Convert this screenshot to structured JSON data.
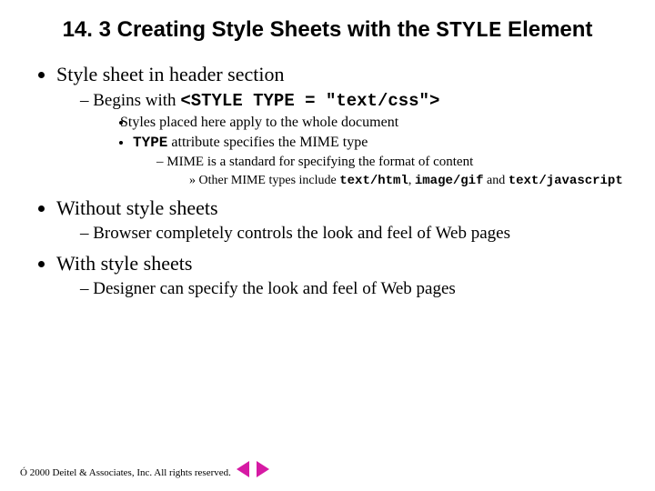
{
  "title": {
    "pre": "14. 3 Creating Style Sheets with the ",
    "code": "STYLE",
    "post": " Element"
  },
  "bullets": {
    "b1": "Style sheet in header section",
    "b1s1_pre": "Begins with ",
    "b1s1_code": "<STYLE TYPE = \"text/css\">",
    "b1s1a": "Styles placed here apply to the whole document",
    "b1s1b_code": "TYPE",
    "b1s1b_post": " attribute specifies the MIME type",
    "b1s1b_i": "MIME is a standard for specifying the format of content",
    "b1s1b_i_a_pre": "Other MIME types include ",
    "b1s1b_i_a_c1": "text/html",
    "b1s1b_i_a_mid1": ", ",
    "b1s1b_i_a_c2": "image/gif",
    "b1s1b_i_a_mid2": " and ",
    "b1s1b_i_a_c3": "text/javascript",
    "b2": "Without style sheets",
    "b2s1": "Browser completely controls the look and feel of Web pages",
    "b3": "With style sheets",
    "b3s1": "Designer can specify the look and feel of Web pages"
  },
  "footer": "Ó 2000 Deitel & Associates, Inc.  All rights reserved."
}
